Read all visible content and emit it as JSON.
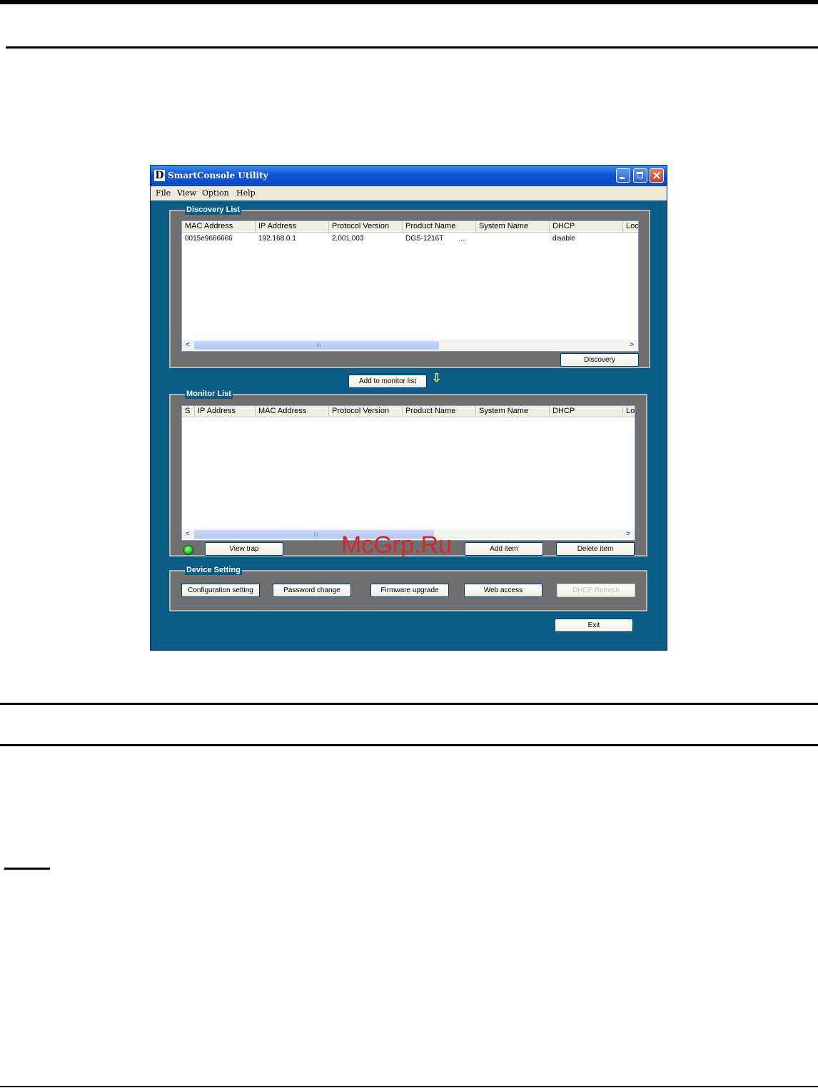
{
  "window": {
    "title": "SmartConsole Utility",
    "app_icon_letter": "D"
  },
  "menu": [
    "File",
    "View",
    "Option",
    "Help"
  ],
  "discovery": {
    "title": "Discovery List",
    "columns": [
      "MAC Address",
      "IP Address",
      "Protocol Version",
      "Product Name",
      "System Name",
      "DHCP",
      "Loc"
    ],
    "rows": [
      [
        "0015e9666666",
        "192.168.0.1",
        "2.001.003",
        "DGS-1216T",
        "...",
        "disable",
        ""
      ]
    ],
    "discovery_button": "Discovery"
  },
  "add_to_monitor_button": "Add to monitor list",
  "monitor": {
    "title": "Monitor List",
    "columns": [
      "S",
      "IP Address",
      "MAC Address",
      "Protocol Version",
      "Product Name",
      "System Name",
      "DHCP",
      "Lo"
    ],
    "view_trap_button": "View trap",
    "add_item_button": "Add item",
    "delete_item_button": "Delete item"
  },
  "device_setting": {
    "title": "Device Setting",
    "buttons": [
      "Configuration setting",
      "Password change",
      "Firmware upgrade",
      "Web access",
      "DHCP Refresh"
    ]
  },
  "exit_button": "Exit",
  "watermark": "McGrp.Ru"
}
